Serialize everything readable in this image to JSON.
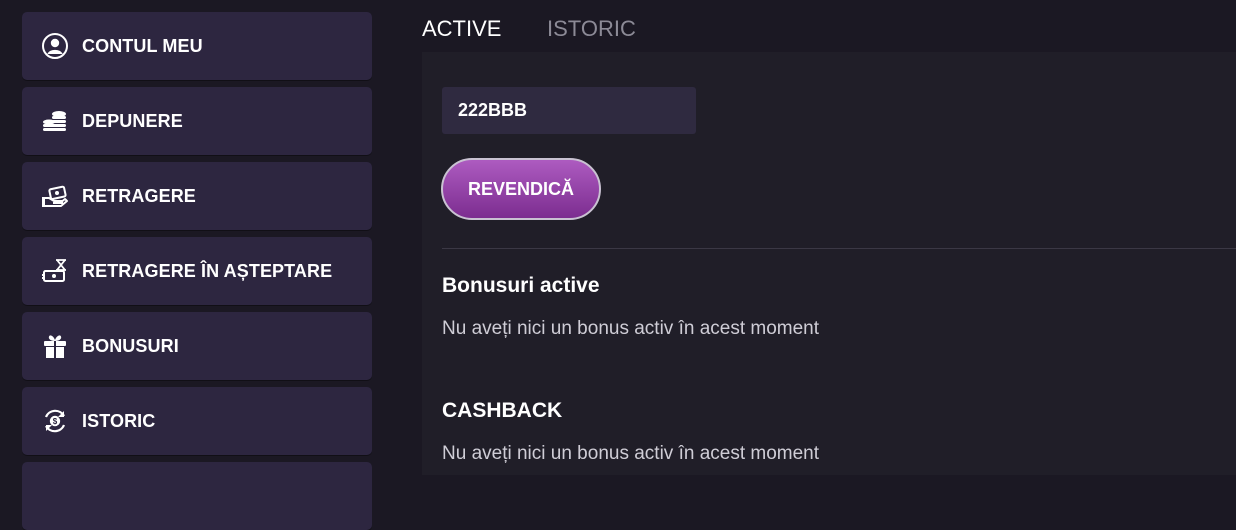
{
  "sidebar": {
    "items": [
      {
        "label": "CONTUL MEU",
        "icon": "user-icon"
      },
      {
        "label": "DEPUNERE",
        "icon": "coins-icon"
      },
      {
        "label": "RETRAGERE",
        "icon": "withdraw-icon"
      },
      {
        "label": "RETRAGERE ÎN AȘTEPTARE",
        "icon": "pending-withdraw-icon"
      },
      {
        "label": "BONUSURI",
        "icon": "gift-icon"
      },
      {
        "label": "ISTORIC",
        "icon": "history-icon"
      }
    ]
  },
  "tabs": [
    {
      "label": "ACTIVE",
      "active": true
    },
    {
      "label": "ISTORIC",
      "active": false
    }
  ],
  "bonus_code": {
    "value": "222BBB"
  },
  "claim_button": {
    "label": "REVENDICĂ"
  },
  "sections": {
    "active_bonuses": {
      "title": "Bonusuri active",
      "message": "Nu aveți nici un bonus activ în acest moment"
    },
    "cashback": {
      "title": "CASHBACK",
      "message": "Nu aveți nici un bonus activ în acest moment"
    }
  },
  "colors": {
    "background": "#1b1823",
    "sidebar_item": "#2d2640",
    "panel": "#201e28",
    "input": "#2f2a40",
    "accent_purple": "#9a46b0",
    "inactive_tab": "#8c8a96"
  }
}
